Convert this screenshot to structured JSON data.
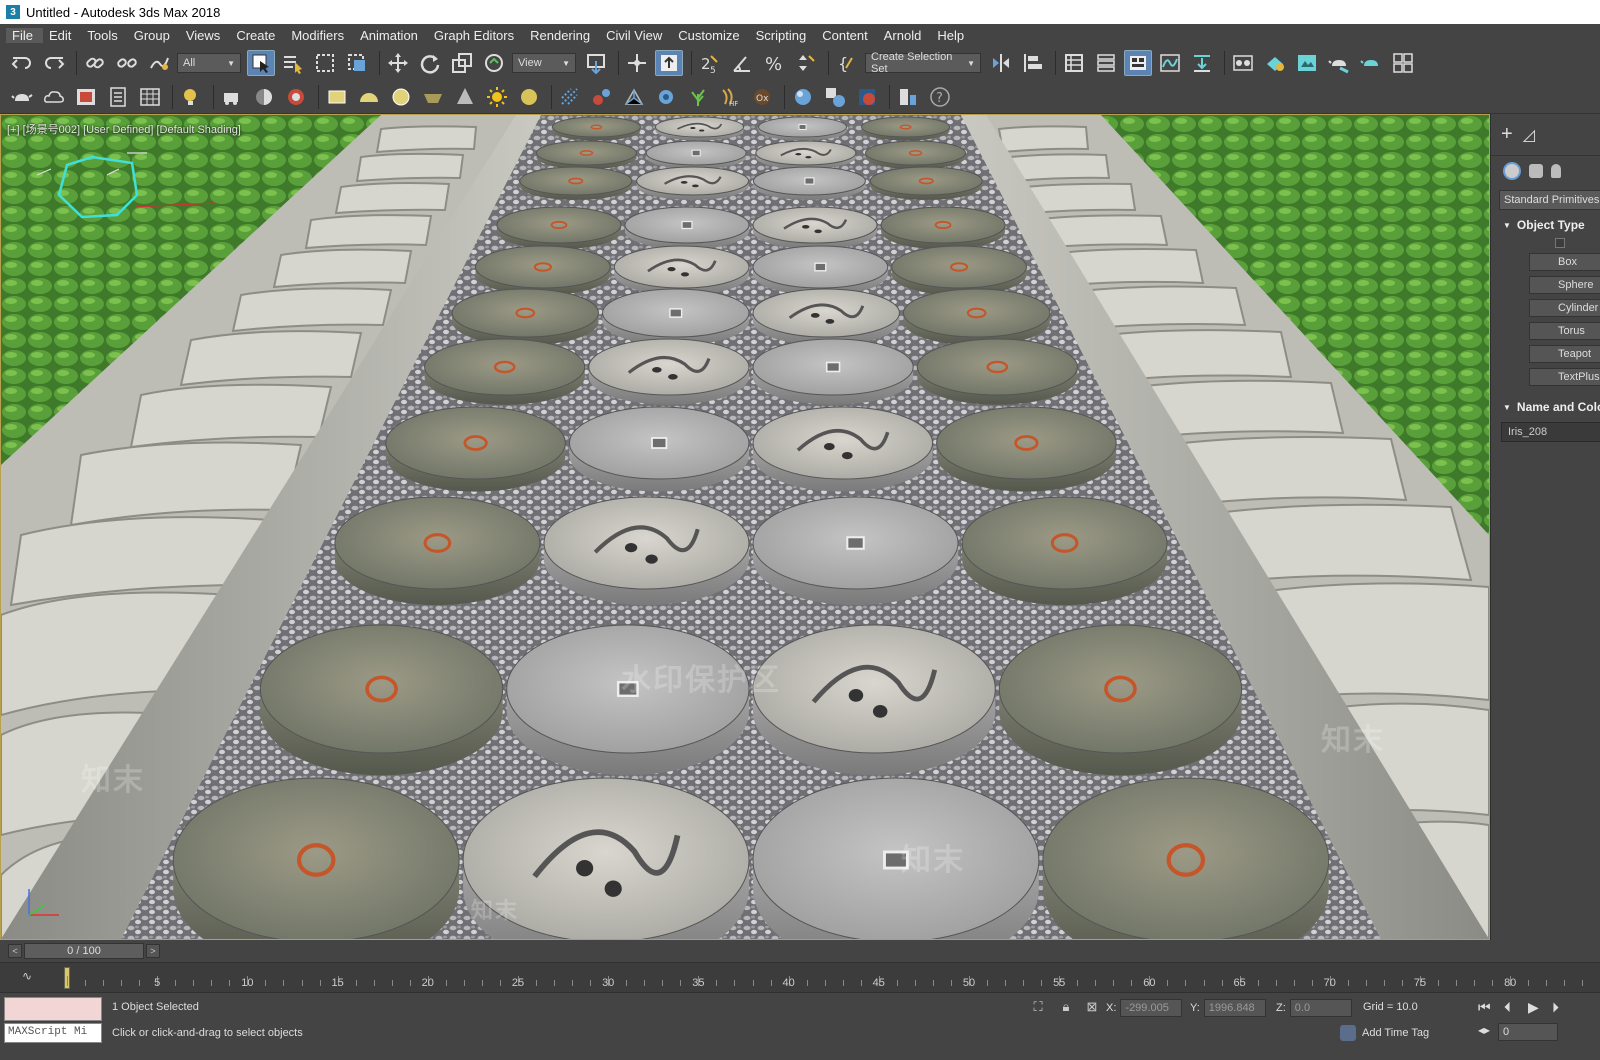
{
  "window": {
    "title": "Untitled - Autodesk 3ds Max 2018",
    "logo": "3"
  },
  "menu": [
    "File",
    "Edit",
    "Tools",
    "Group",
    "Views",
    "Create",
    "Modifiers",
    "Animation",
    "Graph Editors",
    "Rendering",
    "Civil View",
    "Customize",
    "Scripting",
    "Content",
    "Arnold",
    "Help"
  ],
  "toolbar": {
    "selection_filter": "All",
    "ref_coord": "View",
    "named_selection": "Create Selection Set"
  },
  "viewport": {
    "label": "[+] [场景号002] [User Defined] [Default Shading]",
    "watermarks": [
      "水印保护区",
      "知末",
      "知末",
      "知末",
      "知末"
    ]
  },
  "command_panel": {
    "category": "Standard Primitives",
    "object_type_rollout": "Object Type",
    "buttons": [
      "Box",
      "Sphere",
      "Cylinder",
      "Torus",
      "Teapot",
      "TextPlus"
    ],
    "name_rollout": "Name and Color",
    "object_name": "Iris_208"
  },
  "time_slider": {
    "position": "0 / 100",
    "prev": "<",
    "next": ">"
  },
  "track": {
    "ticks": [
      "5",
      "10",
      "15",
      "20",
      "25",
      "30",
      "35",
      "40",
      "45",
      "50",
      "55",
      "60",
      "65",
      "70",
      "75",
      "80"
    ]
  },
  "status": {
    "selection": "1 Object Selected",
    "prompt": "Click or click-and-drag to select objects",
    "maxscript": "MAXScript Mi",
    "x_label": "X:",
    "x": "-299.005",
    "y_label": "Y:",
    "y": "1996.848",
    "z_label": "Z:",
    "z": "0.0",
    "grid": "Grid = 10.0",
    "add_time_tag": "Add Time Tag",
    "frame": "0"
  },
  "colors": {
    "viewport_border": "#b8a04c",
    "active_button": "#5b84b5",
    "ui_bg": "#444444"
  }
}
